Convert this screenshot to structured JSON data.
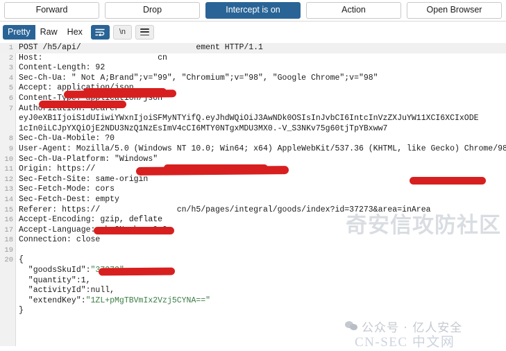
{
  "toolbar": {
    "buttons": [
      {
        "label": "Forward",
        "accent": false
      },
      {
        "label": "Drop",
        "accent": false
      },
      {
        "label": "Intercept is on",
        "accent": true
      },
      {
        "label": "Action",
        "accent": false
      },
      {
        "label": "Open Browser",
        "accent": false
      }
    ],
    "accent_color": "#2a6496"
  },
  "view_tabs": {
    "tabs": [
      {
        "label": "Pretty",
        "active": true
      },
      {
        "label": "Raw",
        "active": false
      },
      {
        "label": "Hex",
        "active": false
      }
    ],
    "icons": [
      {
        "name": "word-wrap-icon",
        "glyph": "⇥",
        "active": true
      },
      {
        "name": "newline-icon",
        "glyph": "\\n",
        "active": false
      },
      {
        "name": "menu-icon",
        "glyph": "hamburger",
        "active": false
      }
    ]
  },
  "editor": {
    "redaction_color": "#d81f1f",
    "lines": [
      {
        "n": "1",
        "text": "POST /h5/api/                        ement HTTP/1.1",
        "highlight": true
      },
      {
        "n": "2",
        "text": "Host:                        cn"
      },
      {
        "n": "3",
        "text": "Content-Length: 92"
      },
      {
        "n": "4",
        "text": "Sec-Ch-Ua: \" Not A;Brand\";v=\"99\", \"Chromium\";v=\"98\", \"Google Chrome\";v=\"98\""
      },
      {
        "n": "5",
        "text": "Accept: application/json"
      },
      {
        "n": "6",
        "text": "Content-Type: application/json"
      },
      {
        "n": "7",
        "text": "Authorization: Bearer"
      },
      {
        "n": "",
        "text": "eyJ0eXB1IjoiS1dUIiwiYWxnIjoiSFMyNTYifQ.eyJhdWQiOiJ3AwNDk0OSIsInJvbCI6IntcInVzZXJuYW11XCI6XCIxODE"
      },
      {
        "n": "",
        "text": "1cIn0iLCJpYXQiOjE2NDU3NzQ1NzEsImV4cCI6MTY0NTgxMDU3MX0.-V_S3NKv75g60tjTpYBxww7"
      },
      {
        "n": "8",
        "text": "Sec-Ch-Ua-Mobile: ?0"
      },
      {
        "n": "9",
        "text": "User-Agent: Mozilla/5.0 (Windows NT 10.0; Win64; x64) AppleWebKit/537.36 (KHTML, like Gecko) Chrome/98"
      },
      {
        "n": "10",
        "text": "Sec-Ch-Ua-Platform: \"Windows\""
      },
      {
        "n": "11",
        "text": "Origin: https://                cn"
      },
      {
        "n": "12",
        "text": "Sec-Fetch-Site: same-origin"
      },
      {
        "n": "13",
        "text": "Sec-Fetch-Mode: cors"
      },
      {
        "n": "14",
        "text": "Sec-Fetch-Dest: empty"
      },
      {
        "n": "15",
        "text": "Referer: https://                cn/h5/pages/integral/goods/index?id=37273&area=inArea"
      },
      {
        "n": "16",
        "text": "Accept-Encoding: gzip, deflate"
      },
      {
        "n": "17",
        "text": "Accept-Language: zh-CN,zh;q=0.9"
      },
      {
        "n": "18",
        "text": "Connection: close"
      },
      {
        "n": "19",
        "text": ""
      },
      {
        "n": "20",
        "text": "{"
      }
    ],
    "body": {
      "open_brace": "{",
      "close_brace": "}",
      "fields": [
        {
          "key": "\"goodsSkuId\"",
          "sep": ":",
          "value": "\"37273\"",
          "trail": ",",
          "value_kind": "string"
        },
        {
          "key": "\"quantity\"",
          "sep": ":",
          "value": "1",
          "trail": ",",
          "value_kind": "number"
        },
        {
          "key": "\"activityId\"",
          "sep": ":",
          "value": "null",
          "trail": ",",
          "value_kind": "null"
        },
        {
          "key": "\"extendKey\"",
          "sep": ":",
          "value": "\"1ZL+pMgTBVmIx2Vzj5CYNA==\"",
          "trail": "",
          "value_kind": "string"
        }
      ]
    }
  },
  "watermarks": {
    "background": "奇安信攻防社区",
    "wechat_label": "公众号 · 亿人安全",
    "site_label": "CN-SEC 中文网"
  }
}
